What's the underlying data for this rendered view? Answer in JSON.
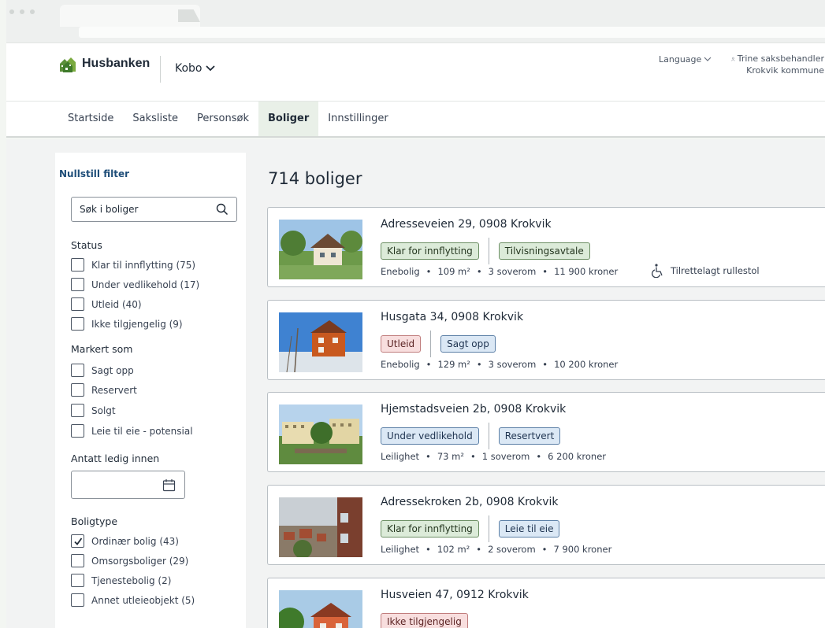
{
  "header": {
    "logo_text": "Husbanken",
    "app_name": "Kobo",
    "language_label": "Language",
    "user_name": "Trine saksbehandler",
    "user_org": "Krokvik kommune"
  },
  "nav": {
    "items": [
      {
        "label": "Startside"
      },
      {
        "label": "Saksliste"
      },
      {
        "label": "Personsøk"
      },
      {
        "label": "Boliger",
        "active": true
      },
      {
        "label": "Innstillinger"
      }
    ]
  },
  "filter": {
    "reset_label": "Nullstill filter",
    "search_placeholder": "Søk i boliger",
    "status_title": "Status",
    "status_options": [
      "Klar til innflytting (75)",
      "Under vedlikehold (17)",
      "Utleid (40)",
      "Ikke tilgjengelig (9)"
    ],
    "marked_title": "Markert som",
    "marked_options": [
      "Sagt opp",
      "Reservert",
      "Solgt",
      "Leie til eie - potensial"
    ],
    "available_title": "Antatt ledig innen",
    "type_title": "Boligtype",
    "type_options": [
      {
        "label": "Ordinær bolig (43)",
        "checked": true
      },
      {
        "label": "Omsorgsboliger (29)",
        "checked": false
      },
      {
        "label": "Tjenestebolig (2)",
        "checked": false
      },
      {
        "label": "Annet utleieobjekt (5)",
        "checked": false
      }
    ]
  },
  "results": {
    "count_label": "714 boliger",
    "listings": [
      {
        "address": "Adresseveien 29, 0908 Krokvik",
        "status": "Klar for innflytting",
        "status_color": "green",
        "mark": "Tilvisningsavtale",
        "mark_color": "green",
        "type": "Enebolig",
        "area": "109 m²",
        "rooms": "3 soverom",
        "price": "11 900 kroner",
        "accessibility": "Tilrettelagt rullestol"
      },
      {
        "address": "Husgata 34, 0908 Krokvik",
        "status": "Utleid",
        "status_color": "red",
        "mark": "Sagt opp",
        "mark_color": "blue",
        "type": "Enebolig",
        "area": "129 m²",
        "rooms": "3 soverom",
        "price": "10 200 kroner"
      },
      {
        "address": "Hjemstadsveien 2b, 0908 Krokvik",
        "status": "Under vedlikehold",
        "status_color": "blue",
        "mark": "Resertvert",
        "mark_color": "blue",
        "type": "Leilighet",
        "area": "73 m²",
        "rooms": "1 soverom",
        "price": "6 200 kroner"
      },
      {
        "address": "Adressekroken 2b, 0908 Krokvik",
        "status": "Klar for innflytting",
        "status_color": "green",
        "mark": "Leie til eie",
        "mark_color": "blue",
        "type": "Leilighet",
        "area": "102 m²",
        "rooms": "2 soverom",
        "price": "7 900 kroner"
      },
      {
        "address": "Husveien 47, 0912 Krokvik",
        "status": "Ikke tilgjengelig",
        "status_color": "red"
      }
    ]
  }
}
